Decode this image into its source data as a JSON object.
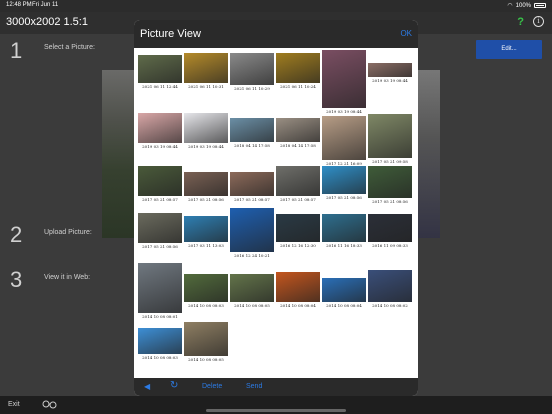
{
  "status": {
    "time": "12:48 PM",
    "date": "Fri Jun 11",
    "battery": "100%"
  },
  "app": {
    "title": "3000x2002 1.5:1",
    "help": "?",
    "info": "i"
  },
  "steps": [
    {
      "num": "1",
      "label": "Select a Picture:"
    },
    {
      "num": "2",
      "label": "Upload Picture:"
    },
    {
      "num": "3",
      "label": "View it in Web:"
    }
  ],
  "edit_label": "Edit...",
  "bottom": {
    "exit_label": "Exit"
  },
  "modal": {
    "title": "Picture View",
    "ok_label": "OK",
    "footer": {
      "delete_label": "Delete",
      "send_label": "Send"
    }
  },
  "thumbnails": [
    {
      "caption": "2021 06 11 12:44",
      "color": "#5f6b4a"
    },
    {
      "caption": "2021 06 11 10:31",
      "color": "#b58b2a"
    },
    {
      "caption": "2021 06 11 10:29",
      "color": "#8a8a8a"
    },
    {
      "caption": "2021 06 11 10:24",
      "color": "#a07d1f"
    },
    {
      "caption": "2019 03 19 08:44",
      "color": "#7a4e62"
    },
    {
      "caption": "2019 03 19 08:44",
      "color": "#8b6e66"
    },
    {
      "caption": "2019 03 19 08:44",
      "color": "#d9a7a7"
    },
    {
      "caption": "2019 03 19 08:44",
      "color": "#e6e6ea"
    },
    {
      "caption": "2018 04 14 17:58",
      "color": "#6b8fa6"
    },
    {
      "caption": "2018 04 14 17:58",
      "color": "#9a8f83"
    },
    {
      "caption": "2017 12 21 16:09",
      "color": "#b79d86"
    },
    {
      "caption": "2017 05 21 09:58",
      "color": "#7f8866"
    },
    {
      "caption": "2017 05 21 08:57",
      "color": "#4a5a3a"
    },
    {
      "caption": "2017 05 21 08:56",
      "color": "#7a6154"
    },
    {
      "caption": "2017 05 21 08:57",
      "color": "#8c6a5a"
    },
    {
      "caption": "2017 05 21 08:57",
      "color": "#6f6f6a"
    },
    {
      "caption": "2017 05 21 08:56",
      "color": "#2f8fc8"
    },
    {
      "caption": "2017 05 21 08:56",
      "color": "#3f5c39"
    },
    {
      "caption": "2017 05 21 08:56",
      "color": "#6b6b5e"
    },
    {
      "caption": "2017 03 11 13:03",
      "color": "#2e7fb3"
    },
    {
      "caption": "2016 12 24 10:21",
      "color": "#1e5fb0"
    },
    {
      "caption": "2016 12 16 12:30",
      "color": "#2a3a45"
    },
    {
      "caption": "2016 11 16 18:33",
      "color": "#2e6f8f"
    },
    {
      "caption": "2016 11 09 08:33",
      "color": "#2b2f38"
    },
    {
      "caption": "2014 10 08 08:01",
      "color": "#707880"
    },
    {
      "caption": "2014 10 08 08:03",
      "color": "#526b3c"
    },
    {
      "caption": "2014 10 08 08:05",
      "color": "#63744a"
    },
    {
      "caption": "2014 10 08 08:04",
      "color": "#c4561e"
    },
    {
      "caption": "2014 10 08 08:04",
      "color": "#2a6fb8"
    },
    {
      "caption": "2014 10 08 08:02",
      "color": "#3a4f7a"
    },
    {
      "caption": "2014 10 08 08:03",
      "color": "#3d8fd6"
    },
    {
      "caption": "2014 10 08 08:05",
      "color": "#8f7f63"
    }
  ]
}
